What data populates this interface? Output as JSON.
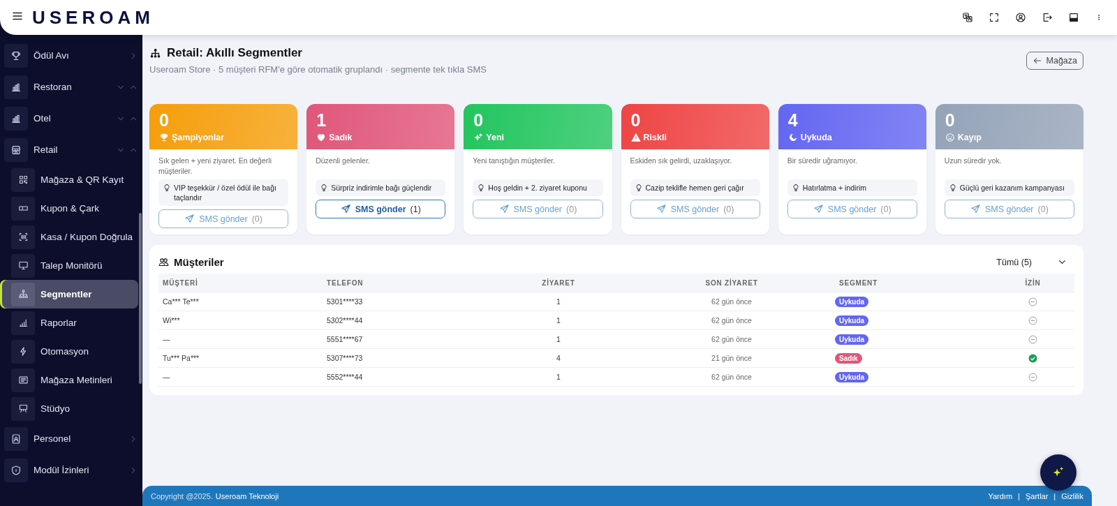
{
  "header": {
    "logo": "USEROAM"
  },
  "sidebar": {
    "items": [
      {
        "label": "Ödül Avı",
        "kind": "link"
      },
      {
        "label": "Restoran",
        "kind": "collapsible"
      },
      {
        "label": "Otel",
        "kind": "collapsible"
      },
      {
        "label": "Retail",
        "kind": "collapsible",
        "children": [
          {
            "label": "Mağaza & QR Kayıt",
            "selected": false
          },
          {
            "label": "Kupon & Çark",
            "selected": false
          },
          {
            "label": "Kasa / Kupon Doğrula",
            "selected": false
          },
          {
            "label": "Talep Monitörü",
            "selected": false
          },
          {
            "label": "Segmentler",
            "selected": true
          },
          {
            "label": "Raporlar",
            "selected": false
          },
          {
            "label": "Otomasyon",
            "selected": false
          },
          {
            "label": "Mağaza Metinleri",
            "selected": false
          },
          {
            "label": "Stüdyo",
            "selected": false
          }
        ]
      },
      {
        "label": "Personel",
        "kind": "link"
      },
      {
        "label": "Modül İzinleri",
        "kind": "link"
      }
    ]
  },
  "page": {
    "title": "Retail: Akıllı Segmentler",
    "subtitle": "Useroam Store · 5 müşteri RFM'e göre otomatik gruplandı · segmente tek tıkla SMS",
    "back_button": "Mağaza"
  },
  "segments": [
    {
      "count": "0",
      "name": "Şampiyonlar",
      "color": "#f59e0b",
      "description": "Sık gelen + yeni ziyaret. En değerli müşteriler.",
      "tip": "VIP teşekkür / özel ödül ile bağı taçlandır",
      "button": "SMS gönder",
      "button_count": "(0)",
      "disabled": true
    },
    {
      "count": "1",
      "name": "Sadık",
      "color": "#e05679",
      "description": "Düzenli gelenler.",
      "tip": "Sürpriz indirimle bağı güçlendir",
      "button": "SMS gönder",
      "button_count": "(1)",
      "disabled": false
    },
    {
      "count": "0",
      "name": "Yeni",
      "color": "#22c55e",
      "description": "Yeni tanıştığın müşteriler.",
      "tip": "Hoş geldin + 2. ziyaret kuponu",
      "button": "SMS gönder",
      "button_count": "(0)",
      "disabled": true
    },
    {
      "count": "0",
      "name": "Riskli",
      "color": "#ef4444",
      "description": "Eskiden sık gelirdi, uzaklaşıyor.",
      "tip": "Cazip teklifle hemen geri çağır",
      "button": "SMS gönder",
      "button_count": "(0)",
      "disabled": true
    },
    {
      "count": "4",
      "name": "Uykuda",
      "color": "#6366f1",
      "description": "Bir süredir uğramıyor.",
      "tip": "Hatırlatma + indirim",
      "button": "SMS gönder",
      "button_count": "(0)",
      "disabled": true
    },
    {
      "count": "0",
      "name": "Kayıp",
      "color": "#94a3b8",
      "description": "Uzun süredir yok.",
      "tip": "Güçlü geri kazanım kampanyası",
      "button": "SMS gönder",
      "button_count": "(0)",
      "disabled": true
    }
  ],
  "customers": {
    "title": "Müşteriler",
    "filter": "Tümü (5)",
    "columns": [
      "MÜŞTERİ",
      "TELEFON",
      "ZİYARET",
      "SON ZİYARET",
      "SEGMENT",
      "İZİN"
    ],
    "rows": [
      {
        "name": "Ca*** Te***",
        "phone": "5301****33",
        "visits": "1",
        "last_visit": "62 gün önce",
        "segment": "Uykuda",
        "color": "#6366f1",
        "consent": false
      },
      {
        "name": "Wi***",
        "phone": "5302****44",
        "visits": "1",
        "last_visit": "62 gün önce",
        "segment": "Uykuda",
        "color": "#6366f1",
        "consent": false
      },
      {
        "name": "—",
        "phone": "5551****67",
        "visits": "1",
        "last_visit": "62 gün önce",
        "segment": "Uykuda",
        "color": "#6366f1",
        "consent": false
      },
      {
        "name": "Tu*** Pa***",
        "phone": "5307****73",
        "visits": "4",
        "last_visit": "21 gün önce",
        "segment": "Sadık",
        "color": "#e05679",
        "consent": true
      },
      {
        "name": "—",
        "phone": "5552****44",
        "visits": "1",
        "last_visit": "62 gün önce",
        "segment": "Uykuda",
        "color": "#6366f1",
        "consent": false
      }
    ]
  },
  "footer": {
    "copyright": "Copyright @2025.",
    "company": "Useroam Teknoloji",
    "links": [
      "Yardım",
      "Şartlar",
      "Gizlilik"
    ],
    "separators": [
      "|",
      "|"
    ]
  }
}
